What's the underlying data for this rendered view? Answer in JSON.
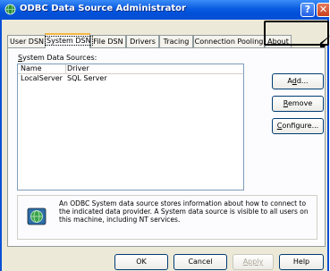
{
  "window": {
    "title": "ODBC Data Source Administrator",
    "help_glyph": "?",
    "close_glyph": "✕"
  },
  "tabs": [
    {
      "label": "User DSN",
      "active": false
    },
    {
      "label": "System DSN",
      "active": true
    },
    {
      "label": "File DSN",
      "active": false
    },
    {
      "label": "Drivers",
      "active": false
    },
    {
      "label": "Tracing",
      "active": false
    },
    {
      "label": "Connection Pooling",
      "active": false
    },
    {
      "label": "About",
      "active": false
    }
  ],
  "panel": {
    "section_label_mnemonic": "S",
    "section_label_rest": "ystem Data Sources:",
    "columns": [
      "Name",
      "Driver"
    ],
    "rows": [
      {
        "name": "LocalServer",
        "driver": "SQL Server"
      }
    ]
  },
  "actions": {
    "add_mn": "",
    "add_pre": "A",
    "add_u": "d",
    "add_post": "d...",
    "remove_u": "R",
    "remove_rest": "emove",
    "configure_u": "C",
    "configure_rest": "onfigure..."
  },
  "info": {
    "text": "An ODBC System data source stores information about how to connect to the indicated data provider.   A System data source is visible to all users on this machine, including NT services.",
    "icon": "odbc-database-icon"
  },
  "footer": {
    "ok": "OK",
    "cancel": "Cancel",
    "apply": "Apply",
    "help": "Help"
  },
  "colors": {
    "titlebar": "#0A5BE0",
    "dialog": "#ECE9D8",
    "active_tab_accent": "#F5B841"
  }
}
